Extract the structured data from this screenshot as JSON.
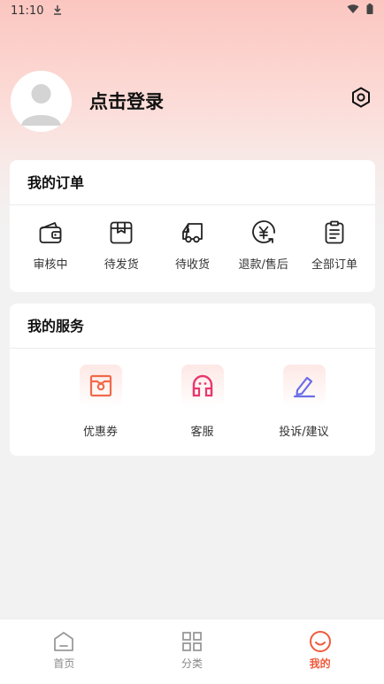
{
  "status_bar": {
    "time": "11:10"
  },
  "profile": {
    "login_label": "点击登录"
  },
  "orders": {
    "title": "我的订单",
    "items": [
      {
        "label": "审核中",
        "icon": "wallet-icon"
      },
      {
        "label": "待发货",
        "icon": "package-icon"
      },
      {
        "label": "待收货",
        "icon": "truck-icon"
      },
      {
        "label": "退款/售后",
        "icon": "refund-icon"
      },
      {
        "label": "全部订单",
        "icon": "clipboard-icon"
      }
    ]
  },
  "services": {
    "title": "我的服务",
    "items": [
      {
        "label": "优惠券",
        "icon": "coupon-icon",
        "color": "#f06a4a"
      },
      {
        "label": "客服",
        "icon": "customer-service-icon",
        "color": "#e8386e"
      },
      {
        "label": "投诉/建议",
        "icon": "edit-icon",
        "color": "#6a6ee8"
      }
    ]
  },
  "bottom_nav": {
    "items": [
      {
        "label": "首页",
        "icon": "home-icon"
      },
      {
        "label": "分类",
        "icon": "grid-icon"
      },
      {
        "label": "我的",
        "icon": "smile-icon"
      }
    ],
    "active": "我的"
  },
  "colors": {
    "accent": "#f05a3c"
  }
}
